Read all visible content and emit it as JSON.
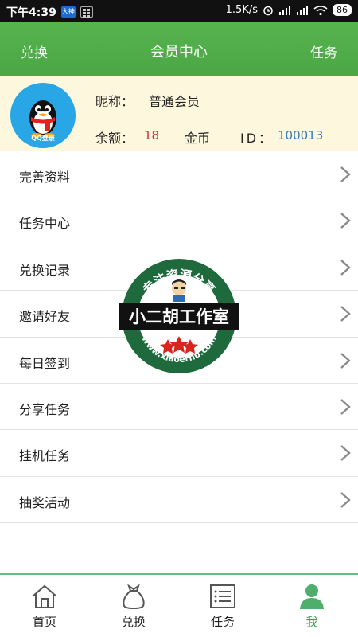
{
  "status_bar": {
    "time": "下午4:39",
    "app_badge": "大神",
    "net_speed": "1.5K/s",
    "battery": "86"
  },
  "header": {
    "left": "兑换",
    "title": "会员中心",
    "right": "任务"
  },
  "profile": {
    "avatar_label": "QQ登录",
    "nickname_label": "昵称：",
    "nickname_value": "普通会员",
    "balance_label": "余额：",
    "balance_value": "18",
    "coin_label": "金币",
    "id_label": "ID：",
    "id_value": "100013"
  },
  "menu": {
    "items": [
      {
        "label": "完善资料"
      },
      {
        "label": "任务中心"
      },
      {
        "label": "兑换记录"
      },
      {
        "label": "邀请好友"
      },
      {
        "label": "每日签到"
      },
      {
        "label": "分享任务"
      },
      {
        "label": "挂机任务"
      },
      {
        "label": "抽奖活动"
      }
    ]
  },
  "watermark": {
    "top_text": "专注资源分享",
    "banner_text": "小二胡工作室",
    "url_text": "www.xiaoerhu.com"
  },
  "bottom_nav": {
    "items": [
      {
        "label": "首页",
        "icon": "home-icon"
      },
      {
        "label": "兑换",
        "icon": "money-bag-icon"
      },
      {
        "label": "任务",
        "icon": "list-icon"
      },
      {
        "label": "我",
        "icon": "user-icon"
      }
    ],
    "active_color": "#3d9b57"
  },
  "colors": {
    "header_green": "#4aa744",
    "profile_bg": "#fdf7dd",
    "balance_red": "#c8362b",
    "id_blue": "#2c7dc4"
  }
}
